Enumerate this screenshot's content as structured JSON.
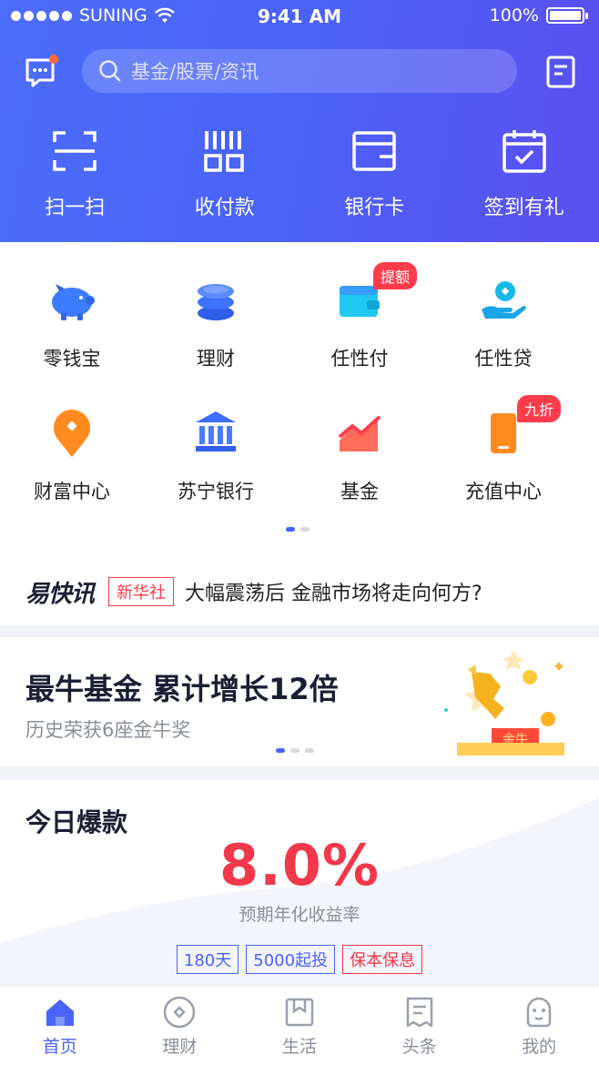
{
  "status_bar": {
    "carrier": "SUNING",
    "time": "9:41 AM",
    "battery": "100%"
  },
  "search": {
    "placeholder": "基金/股票/资讯"
  },
  "quick_actions": [
    {
      "label": "扫一扫",
      "icon": "scan-icon"
    },
    {
      "label": "收付款",
      "icon": "payment-code-icon"
    },
    {
      "label": "银行卡",
      "icon": "bank-card-icon"
    },
    {
      "label": "签到有礼",
      "icon": "calendar-check-icon"
    }
  ],
  "services": [
    {
      "label": "零钱宝",
      "icon": "piggy-bank-icon"
    },
    {
      "label": "理财",
      "icon": "coin-stack-icon"
    },
    {
      "label": "任性付",
      "icon": "wallet-icon",
      "badge": "提额"
    },
    {
      "label": "任性贷",
      "icon": "loan-hand-icon"
    },
    {
      "label": "财富中心",
      "icon": "wealth-pin-icon"
    },
    {
      "label": "苏宁银行",
      "icon": "bank-building-icon"
    },
    {
      "label": "基金",
      "icon": "fund-chart-icon"
    },
    {
      "label": "充值中心",
      "icon": "phone-recharge-icon",
      "badge": "九折"
    }
  ],
  "news": {
    "logo": "易快讯",
    "source": "新华社",
    "headline": "大幅震荡后 金融市场将走向何方?"
  },
  "banner": {
    "title": "最牛基金 累计增长12倍",
    "subtitle": "历史荣获6座金牛奖",
    "art_text": "金牛"
  },
  "hot": {
    "title": "今日爆款",
    "rate": "8.0%",
    "rate_label": "预期年化收益率",
    "tags": [
      "180天",
      "5000起投",
      "保本保息"
    ]
  },
  "tabbar": [
    {
      "label": "首页",
      "icon": "home-icon",
      "active": true
    },
    {
      "label": "理财",
      "icon": "finance-icon",
      "active": false
    },
    {
      "label": "生活",
      "icon": "life-bag-icon",
      "active": false
    },
    {
      "label": "头条",
      "icon": "headline-icon",
      "active": false
    },
    {
      "label": "我的",
      "icon": "profile-icon",
      "active": false
    }
  ],
  "colors": {
    "primary": "#4a63f8",
    "accent_red": "#f2384a",
    "orange": "#ff8a1f"
  }
}
